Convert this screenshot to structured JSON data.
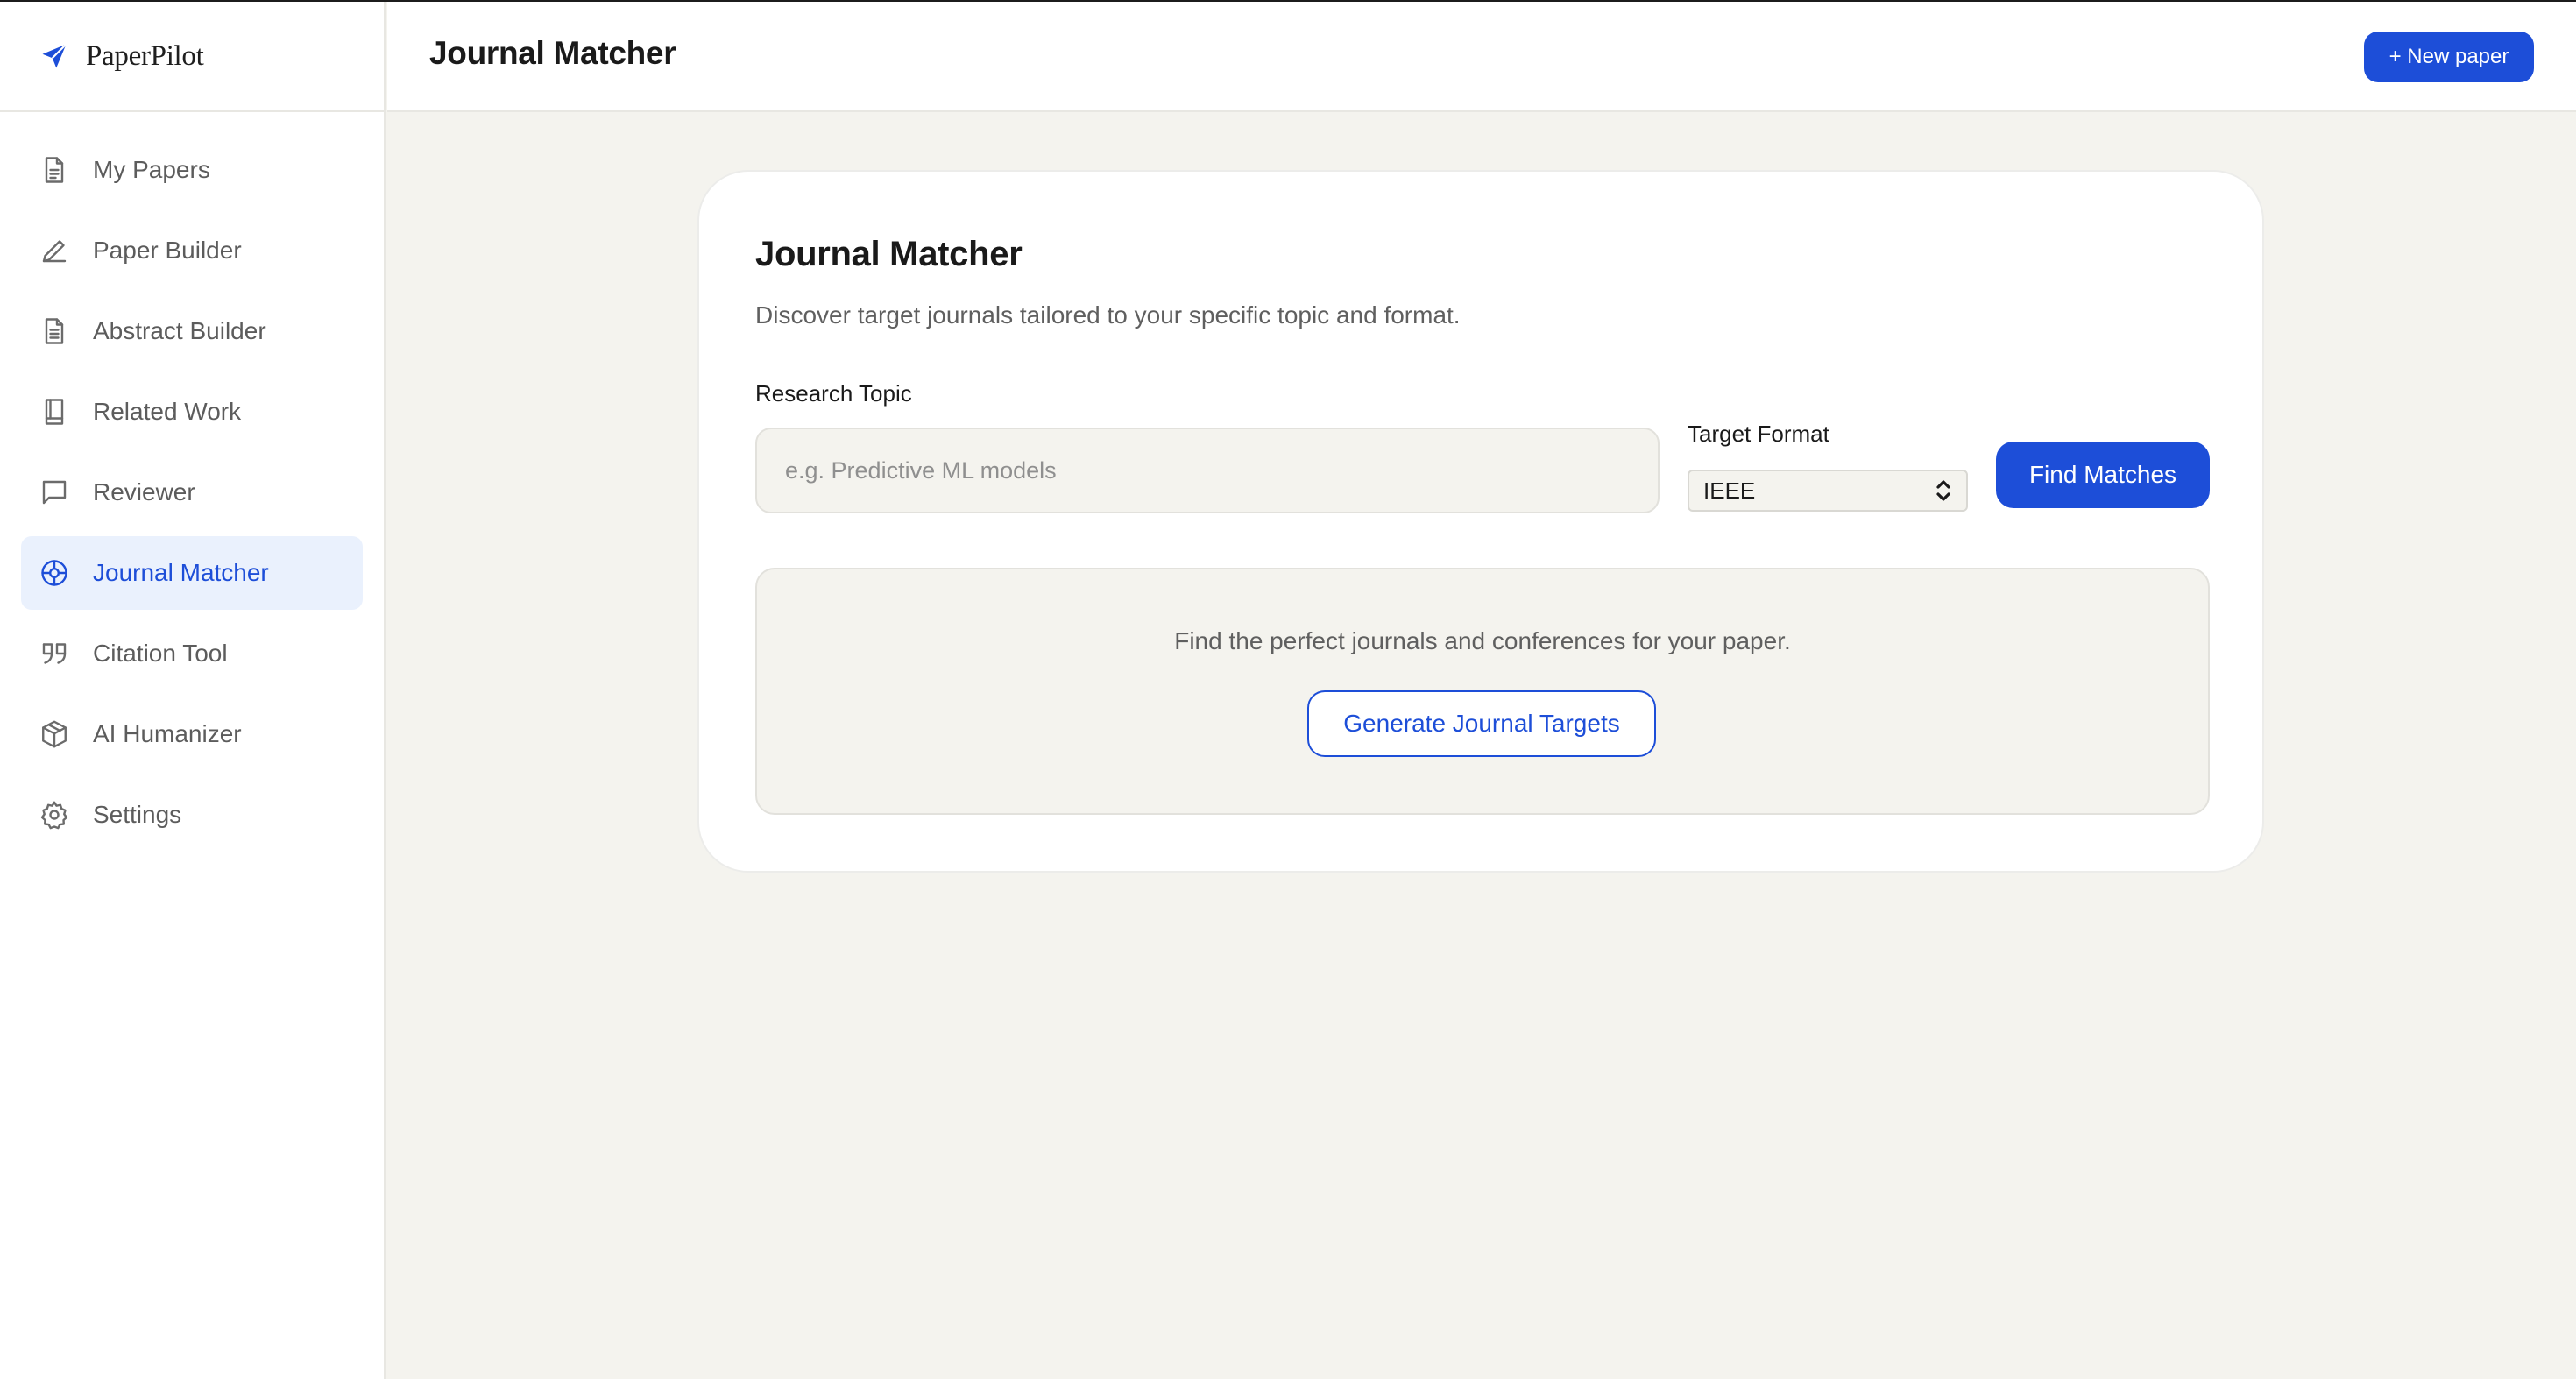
{
  "app": {
    "name": "PaperPilot",
    "logo_icon": "paper-plane-icon"
  },
  "colors": {
    "accent": "#1d4ed8",
    "background": "#f4f3ee",
    "active_nav_bg": "#eaf1fd"
  },
  "sidebar": {
    "items": [
      {
        "label": "My Papers",
        "icon": "document-icon",
        "active": false
      },
      {
        "label": "Paper Builder",
        "icon": "pencil-icon",
        "active": false
      },
      {
        "label": "Abstract Builder",
        "icon": "document-text-icon",
        "active": false
      },
      {
        "label": "Related Work",
        "icon": "book-icon",
        "active": false
      },
      {
        "label": "Reviewer",
        "icon": "chat-bubble-icon",
        "active": false
      },
      {
        "label": "Journal Matcher",
        "icon": "target-icon",
        "active": true
      },
      {
        "label": "Citation Tool",
        "icon": "quote-icon",
        "active": false
      },
      {
        "label": "AI Humanizer",
        "icon": "cube-icon",
        "active": false
      },
      {
        "label": "Settings",
        "icon": "gear-icon",
        "active": false
      }
    ]
  },
  "header": {
    "title": "Journal Matcher",
    "new_paper_label": "+ New paper"
  },
  "main": {
    "title": "Journal Matcher",
    "subtitle": "Discover target journals tailored to your specific topic and format.",
    "topic": {
      "label": "Research Topic",
      "placeholder": "e.g. Predictive ML models",
      "value": ""
    },
    "format": {
      "label": "Target Format",
      "selected": "IEEE"
    },
    "find_label": "Find Matches",
    "empty_state": {
      "text": "Find the perfect journals and conferences for your paper.",
      "button_label": "Generate Journal Targets"
    }
  }
}
